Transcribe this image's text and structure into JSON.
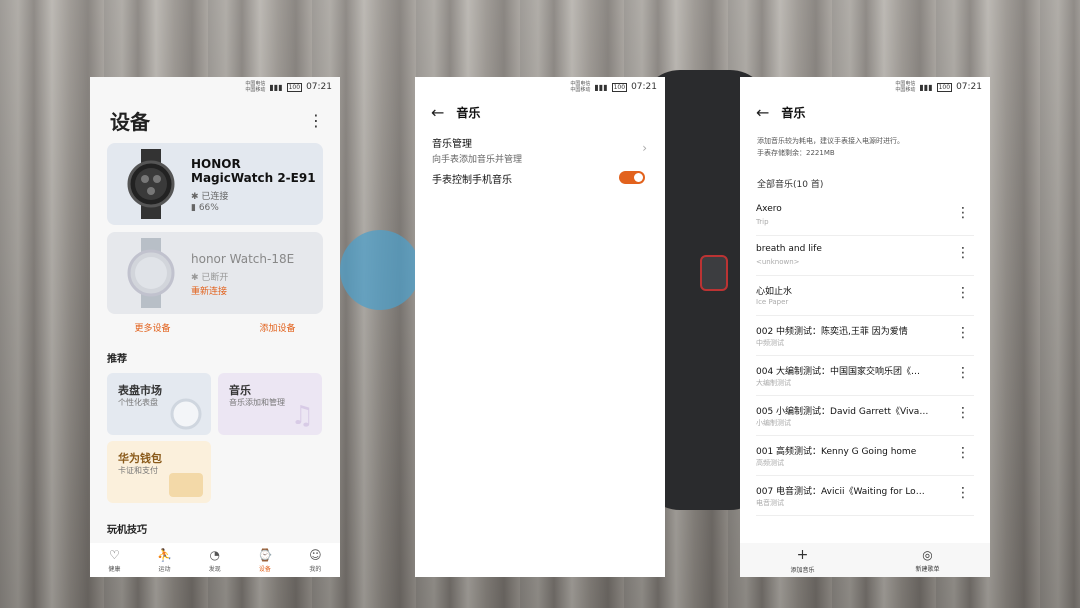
{
  "status": {
    "carrier1": "中国电信",
    "carrier2": "中国移动",
    "battery": "100",
    "time": "07:21"
  },
  "devices_screen": {
    "title": "设备",
    "devices": [
      {
        "name": "HONOR MagicWatch 2-E91",
        "bt_status": "已连接",
        "battery": "66%"
      },
      {
        "name": "honor Watch-18E",
        "bt_status": "已断开",
        "action": "重新连接"
      }
    ],
    "more_devices": "更多设备",
    "add_device": "添加设备",
    "recommend_title": "推荐",
    "tiles": [
      {
        "title": "表盘市场",
        "subtitle": "个性化表盘"
      },
      {
        "title": "音乐",
        "subtitle": "音乐添加和管理"
      },
      {
        "title": "华为钱包",
        "subtitle": "卡证和支付"
      }
    ],
    "tips_title": "玩机技巧",
    "tabs": [
      "健康",
      "运动",
      "发现",
      "设备",
      "我的"
    ]
  },
  "music_settings": {
    "title": "音乐",
    "manage_title": "音乐管理",
    "manage_sub": "向手表添加音乐并管理",
    "control_label": "手表控制手机音乐",
    "control_enabled": true
  },
  "music_list": {
    "title": "音乐",
    "note1": "添加音乐较为耗电，建议手表接入电源时进行。",
    "note2": "手表存储剩余：2221MB",
    "all_title": "全部音乐(10 首)",
    "songs": [
      {
        "name": "Axero",
        "artist": "Trip"
      },
      {
        "name": "breath and life",
        "artist": "<unknown>"
      },
      {
        "name": "心如止水",
        "artist": "Ice Paper"
      },
      {
        "name": "002 中频测试：陈奕迅,王菲 因为爱情",
        "artist": "中频测试"
      },
      {
        "name": "004 大编制测试：中国国家交响乐团《…",
        "artist": "大编制测试"
      },
      {
        "name": "005 小编制测试：David Garrett《Viva…",
        "artist": "小编制测试"
      },
      {
        "name": "001 高频测试：Kenny G  Going home",
        "artist": "高频测试"
      },
      {
        "name": "007 电音测试：Avicii《Waiting for Lo…",
        "artist": "电音测试"
      }
    ],
    "add_music": "添加音乐",
    "new_playlist": "新建歌单"
  },
  "colors": {
    "accent": "#e2621d"
  }
}
